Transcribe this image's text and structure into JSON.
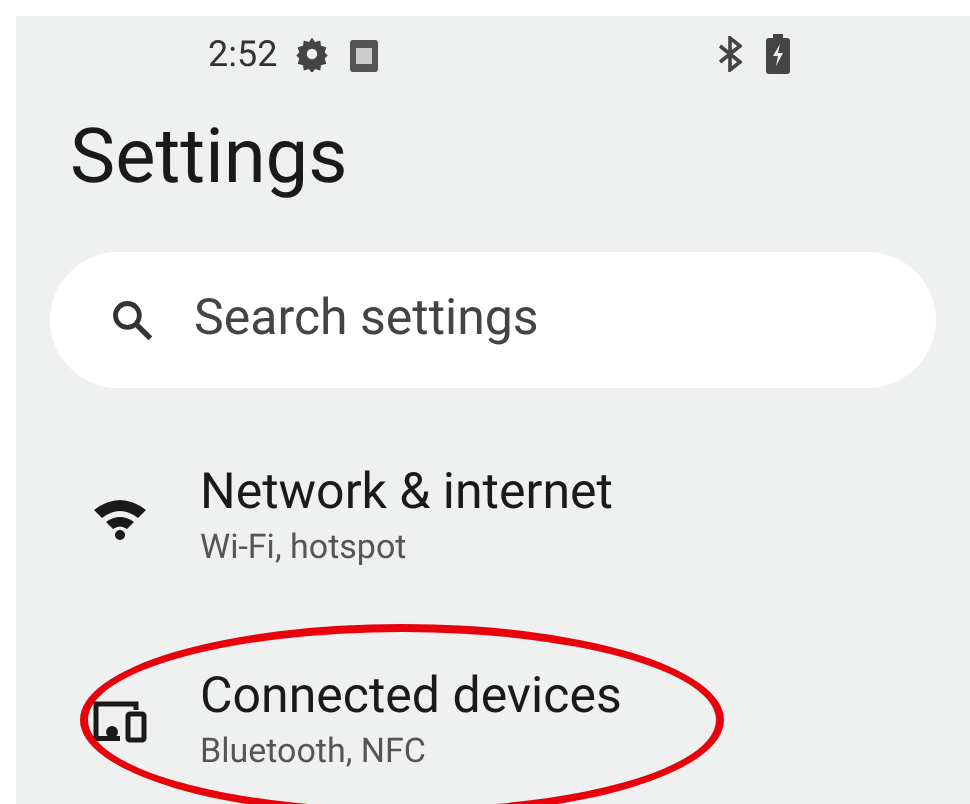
{
  "status_bar": {
    "time": "2:52"
  },
  "title": "Settings",
  "search": {
    "placeholder": "Search settings"
  },
  "items": [
    {
      "kind": "wifi",
      "title": "Network & internet",
      "subtitle": "Wi-Fi, hotspot",
      "highlighted": false
    },
    {
      "kind": "devices",
      "title": "Connected devices",
      "subtitle": "Bluetooth, NFC",
      "highlighted": true
    }
  ]
}
